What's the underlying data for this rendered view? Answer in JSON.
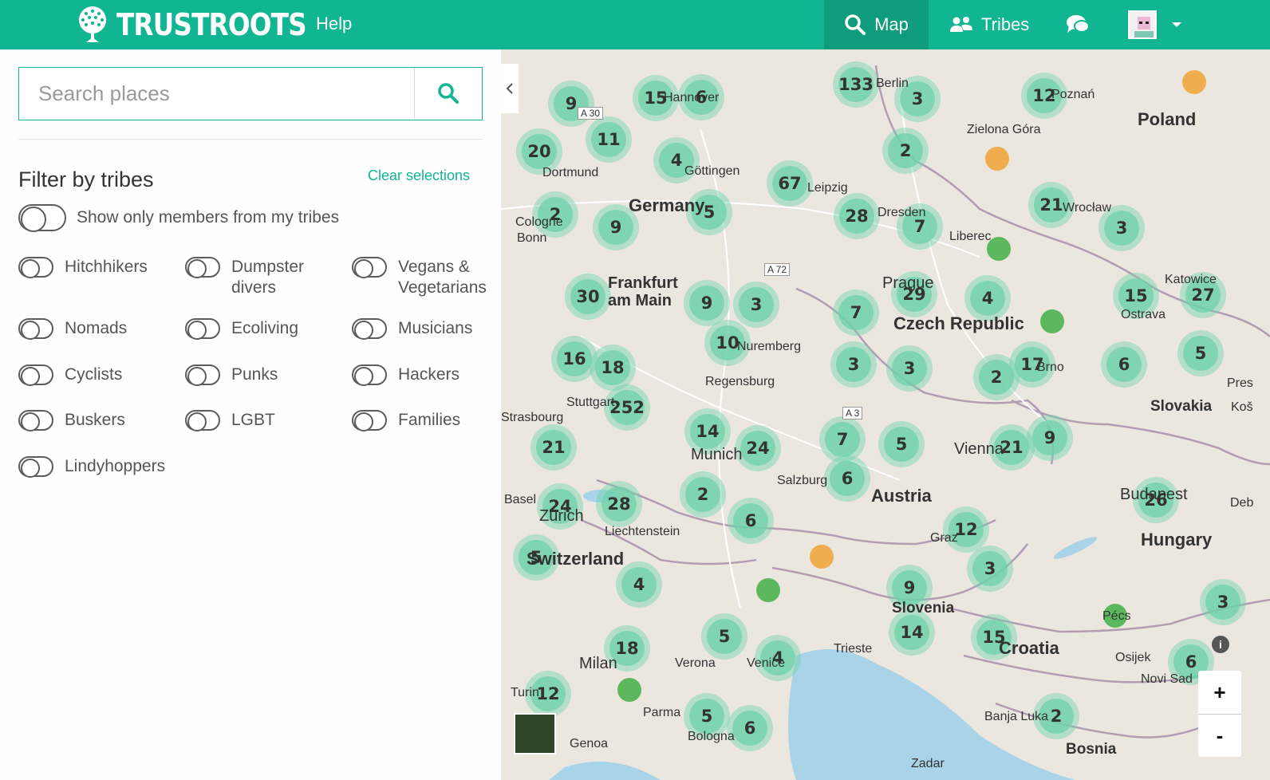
{
  "app": {
    "name": "TRUSTROOTS"
  },
  "nav": {
    "help": "Help",
    "map": "Map",
    "tribes": "Tribes"
  },
  "search": {
    "placeholder": "Search places"
  },
  "filter": {
    "title": "Filter by tribes",
    "clear": "Clear selections",
    "my_tribes_label": "Show only members from my tribes",
    "tribes": [
      "Hitchhikers",
      "Dumpster divers",
      "Vegans & Vegetarians",
      "Nomads",
      "Ecoliving",
      "Musicians",
      "Cyclists",
      "Punks",
      "Hackers",
      "Buskers",
      "LGBT",
      "Families",
      "Lindyhoppers"
    ]
  },
  "map": {
    "clusters": [
      "133",
      "3",
      "12",
      "9",
      "15",
      "6",
      "11",
      "20",
      "4",
      "2",
      "67",
      "28",
      "7",
      "21",
      "3",
      "2",
      "9",
      "5",
      "30",
      "9",
      "3",
      "10",
      "7",
      "29",
      "4",
      "15",
      "27",
      "16",
      "18",
      "3",
      "3",
      "2",
      "17",
      "6",
      "5",
      "252",
      "14",
      "24",
      "7",
      "5",
      "21",
      "9",
      "21",
      "24",
      "28",
      "2",
      "6",
      "6",
      "12",
      "26",
      "5",
      "4",
      "9",
      "3",
      "3",
      "5",
      "4",
      "14",
      "15",
      "18",
      "6",
      "12",
      "5",
      "6",
      "2"
    ],
    "dot_colors": {
      "member": "#5cb85c",
      "host": "#f0ad4e"
    },
    "places": [
      "Berlin",
      "Poznań",
      "Zielona Góra",
      "Hannover",
      "A 30",
      "Dortmund",
      "Göttingen",
      "Leipzig",
      "Cologne",
      "Bonn",
      "Dresden",
      "Liberec",
      "Wrocław",
      "Katowice",
      "Ostrava",
      "A 72",
      "Prague",
      "Frankfurt am Main",
      "Nuremberg",
      "Regensburg",
      "Brno",
      "Stuttgart",
      "Strasbourg",
      "A 3",
      "Munich",
      "Salzburg",
      "Vienna",
      "Basel",
      "Zurich",
      "Liechtenstein",
      "Graz",
      "Budapest",
      "Milan",
      "Verona",
      "Venice",
      "Trieste",
      "Pécs",
      "Osijek",
      "Novi Sad",
      "Turin",
      "Parma",
      "Bologna",
      "Genoa",
      "Banja Luka",
      "Zadar",
      "Pres",
      "Koš",
      "Deb"
    ],
    "countries": [
      "Poland",
      "Germany",
      "Czech Republic",
      "Slovakia",
      "Austria",
      "Switzerland",
      "Hungary",
      "Slovenia",
      "Croatia",
      "Bosnia"
    ],
    "zoom_in": "+",
    "zoom_out": "-",
    "info": "i"
  }
}
